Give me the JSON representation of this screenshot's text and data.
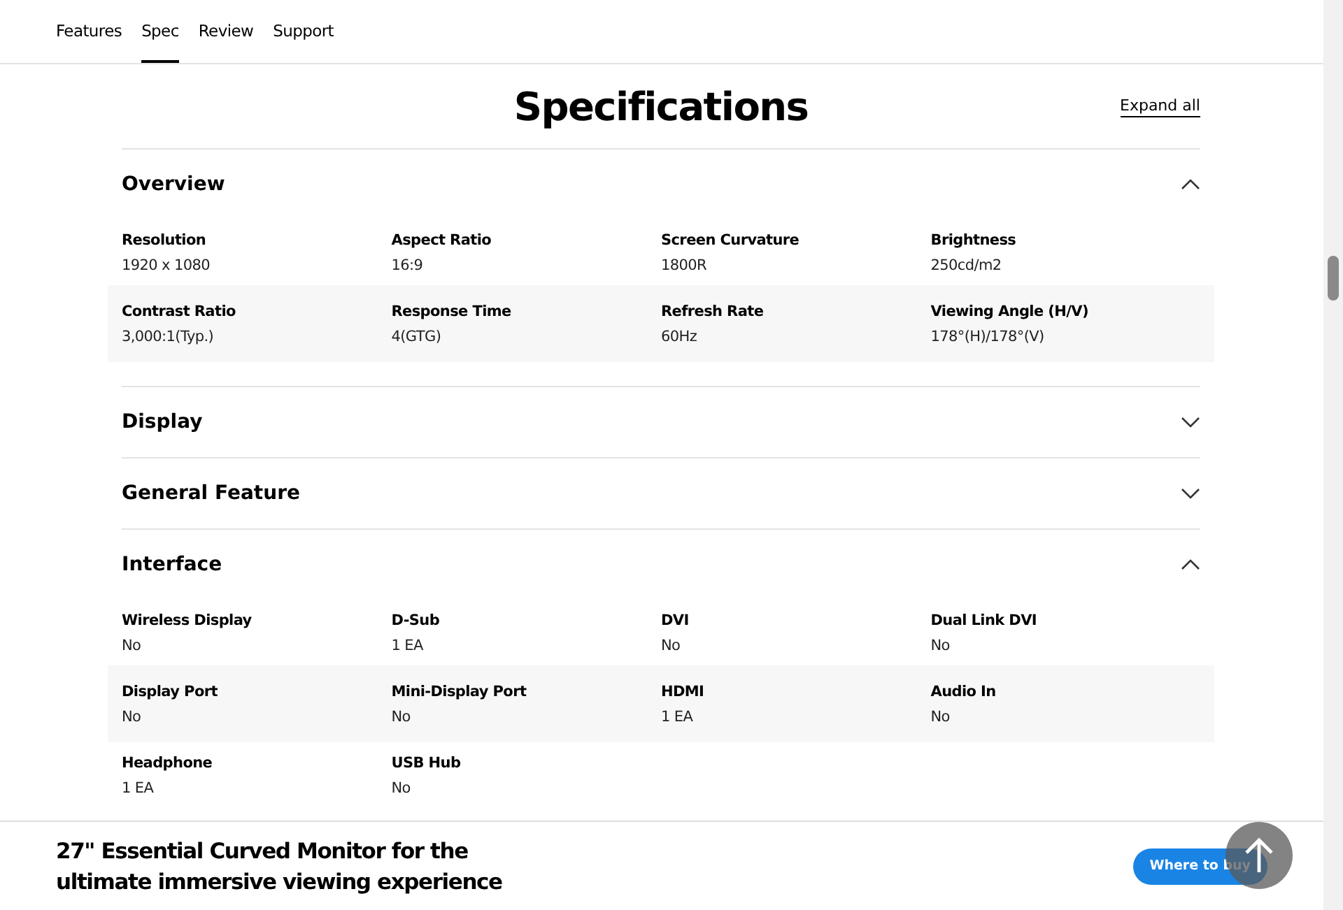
{
  "nav": {
    "tabs": [
      {
        "label": "Features",
        "selected": false
      },
      {
        "label": "Spec",
        "selected": true
      },
      {
        "label": "Review",
        "selected": false
      },
      {
        "label": "Support",
        "selected": false
      }
    ]
  },
  "title": "Specifications",
  "expand_all": "Expand all",
  "sections": [
    {
      "name": "Overview",
      "expanded": true,
      "specs": [
        {
          "label": "Resolution",
          "value": "1920 x 1080"
        },
        {
          "label": "Aspect Ratio",
          "value": "16:9"
        },
        {
          "label": "Screen Curvature",
          "value": "1800R"
        },
        {
          "label": "Brightness",
          "value": "250cd/m2"
        },
        {
          "label": "Contrast Ratio",
          "value": "3,000:1(Typ.)"
        },
        {
          "label": "Response Time",
          "value": "4(GTG)"
        },
        {
          "label": "Refresh Rate",
          "value": "60Hz"
        },
        {
          "label": "Viewing Angle (H/V)",
          "value": "178°(H)/178°(V)"
        }
      ]
    },
    {
      "name": "Display",
      "expanded": false
    },
    {
      "name": "General Feature",
      "expanded": false
    },
    {
      "name": "Interface",
      "expanded": true,
      "specs": [
        {
          "label": "Wireless Display",
          "value": "No"
        },
        {
          "label": "D-Sub",
          "value": "1 EA"
        },
        {
          "label": "DVI",
          "value": "No"
        },
        {
          "label": "Dual Link DVI",
          "value": "No"
        },
        {
          "label": "Display Port",
          "value": "No"
        },
        {
          "label": "Mini-Display Port",
          "value": "No"
        },
        {
          "label": "HDMI",
          "value": "1 EA"
        },
        {
          "label": "Audio In",
          "value": "No"
        },
        {
          "label": "Headphone",
          "value": "1 EA"
        },
        {
          "label": "USB Hub",
          "value": "No"
        }
      ]
    }
  ],
  "footer": {
    "product": "27\" Essential Curved Monitor for the ultimate immersive viewing experience",
    "button": "Where to buy"
  }
}
